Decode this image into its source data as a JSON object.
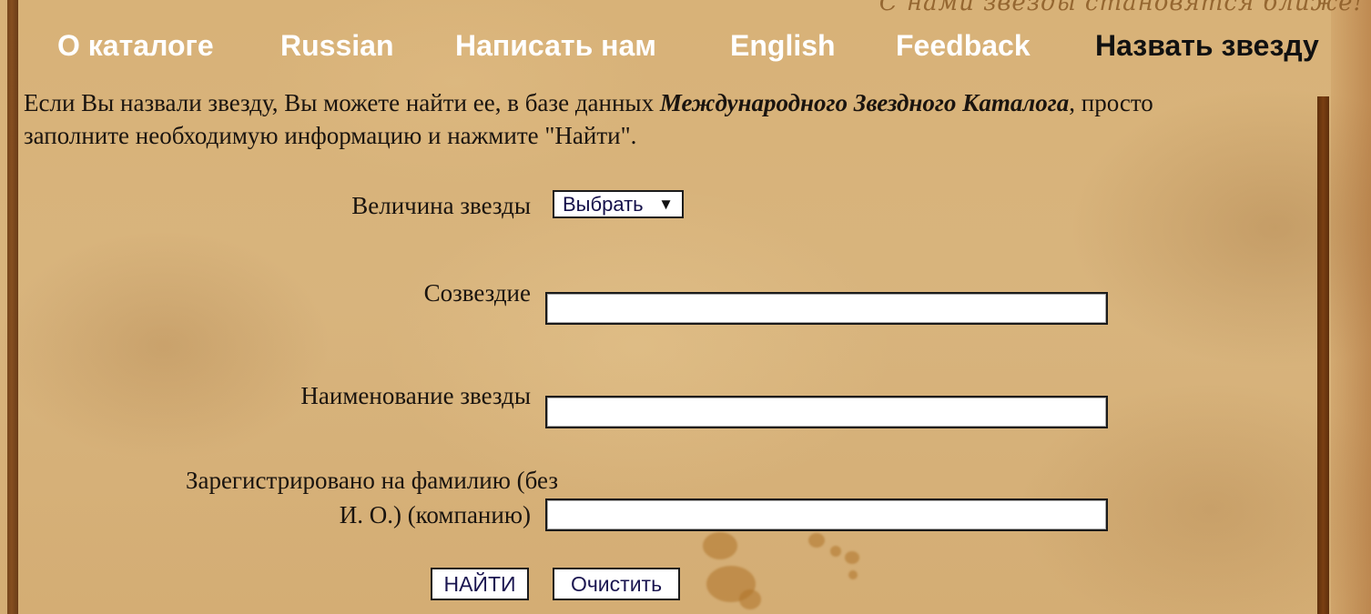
{
  "header": {
    "slogan": "С нами звезды становятся ближе!"
  },
  "nav": {
    "items": [
      {
        "label": "О каталоге",
        "active": false
      },
      {
        "label": "Russian",
        "active": false
      },
      {
        "label": "Написать нам",
        "active": false
      },
      {
        "label": "English",
        "active": false
      },
      {
        "label": "Feedback",
        "active": false
      },
      {
        "label": "Назвать звезду",
        "active": true
      }
    ]
  },
  "intro": {
    "part1": "Если Вы назвали звезду, Вы можете найти ее, в базе данных ",
    "emphasis": "Международного Звездного Каталога",
    "part2": ", просто заполните необходимую информацию и нажмите \"Найти\"."
  },
  "form": {
    "magnitude": {
      "label": "Величина звезды",
      "selected": "Выбрать",
      "arrow_icon": "▼"
    },
    "constellation": {
      "label": "Созвездие",
      "value": ""
    },
    "star_name": {
      "label": "Наименование звезды",
      "value": ""
    },
    "registered_to": {
      "label_line1": "Зарегистрировано на фамилию (без",
      "label_line2": "И. О.) (компанию)",
      "value": ""
    },
    "search_button": "НАЙТИ",
    "clear_button": "Очистить"
  },
  "colors": {
    "nav_text": "#ffffff",
    "nav_active_text": "#111111",
    "parchment": "#d9b47a",
    "border_brown": "#6b3a12"
  }
}
